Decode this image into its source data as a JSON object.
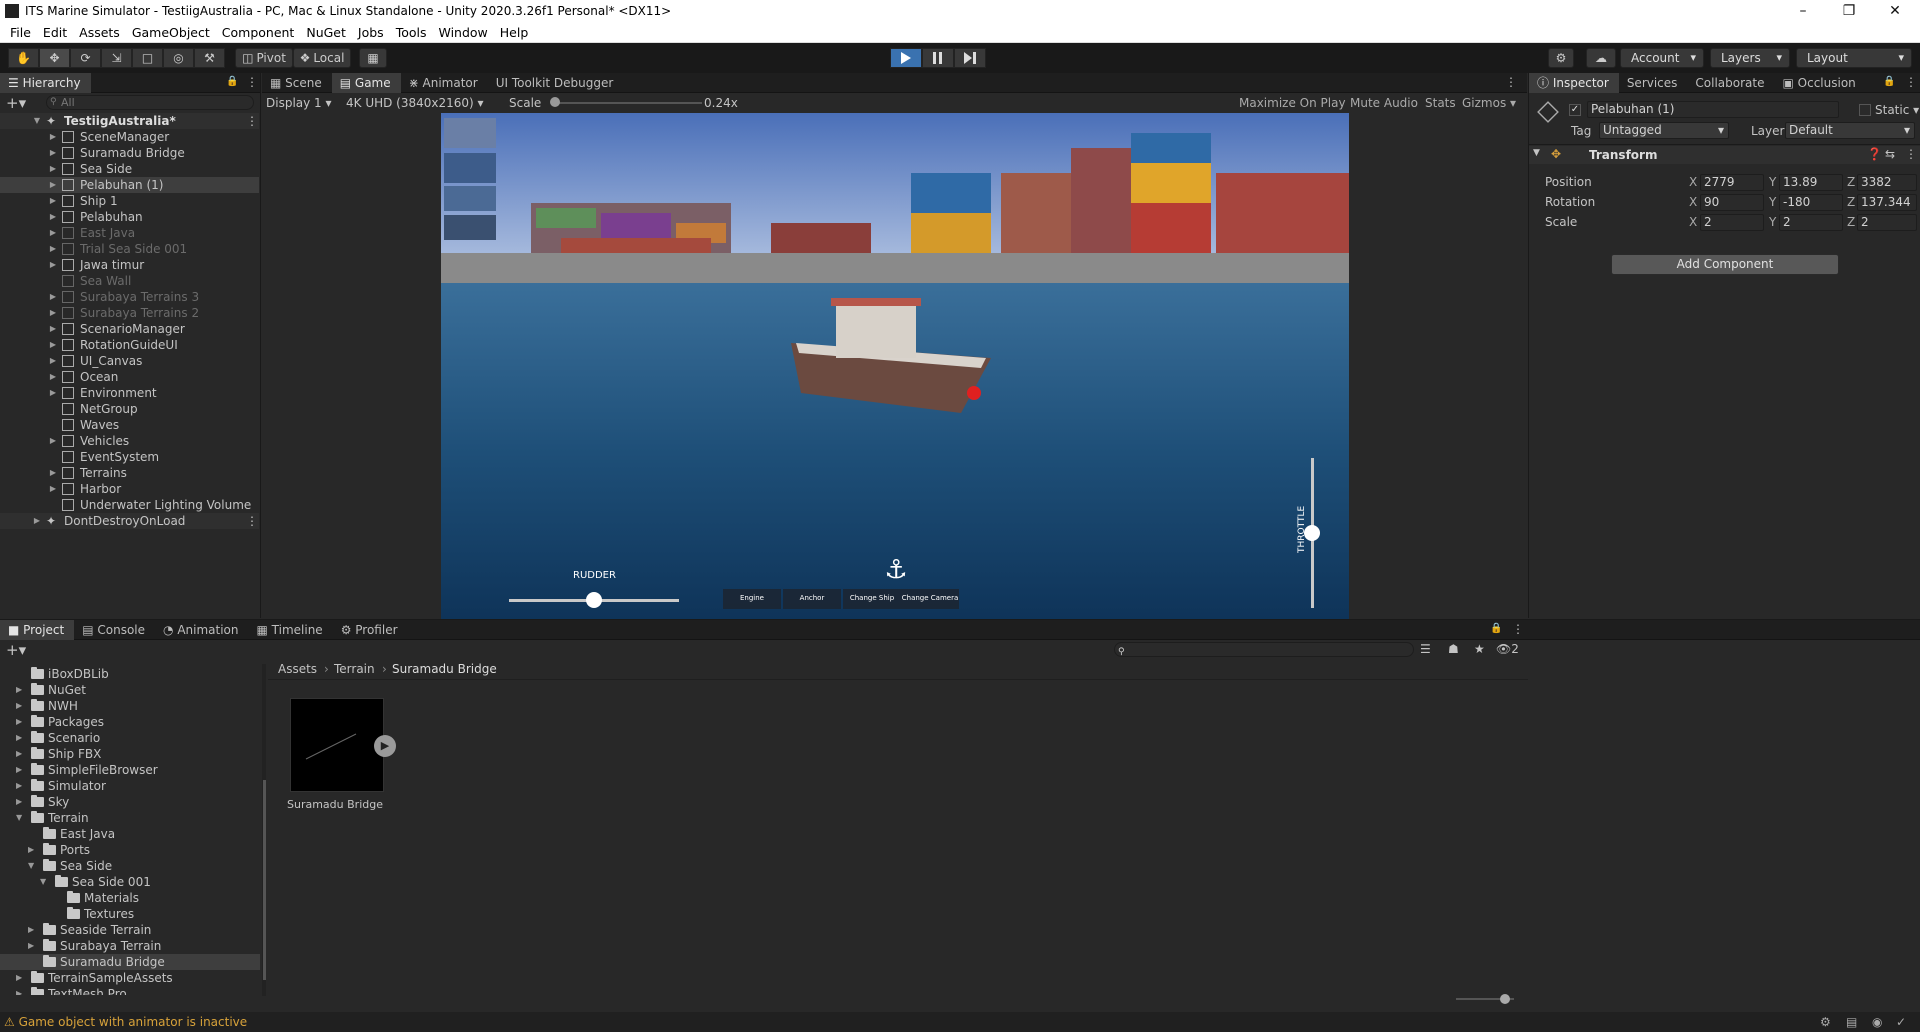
{
  "window": {
    "title": "ITS Marine Simulator - TestiigAustralia - PC, Mac & Linux Standalone - Unity 2020.3.26f1 Personal* <DX11>"
  },
  "menu": [
    "File",
    "Edit",
    "Assets",
    "GameObject",
    "Component",
    "NuGet",
    "Jobs",
    "Tools",
    "Window",
    "Help"
  ],
  "toolbar": {
    "pivot": "Pivot",
    "local": "Local",
    "account": "Account",
    "layers": "Layers",
    "layout": "Layout"
  },
  "hierarchy": {
    "tab": "Hierarchy",
    "search_placeholder": "All",
    "scene": "TestiigAustralia*",
    "items": [
      {
        "name": "SceneManager",
        "dim": false,
        "arrow": true
      },
      {
        "name": "Suramadu Bridge",
        "dim": false,
        "arrow": true
      },
      {
        "name": "Sea Side",
        "dim": false,
        "arrow": true
      },
      {
        "name": "Pelabuhan (1)",
        "dim": false,
        "arrow": true,
        "selected": true
      },
      {
        "name": "Ship 1",
        "dim": false,
        "arrow": true
      },
      {
        "name": "Pelabuhan",
        "dim": false,
        "arrow": true
      },
      {
        "name": "East Java",
        "dim": true,
        "arrow": true
      },
      {
        "name": "Trial Sea Side 001",
        "dim": true,
        "arrow": true
      },
      {
        "name": "Jawa timur",
        "dim": false,
        "arrow": true
      },
      {
        "name": "Sea Wall",
        "dim": true,
        "arrow": false
      },
      {
        "name": "Surabaya Terrains 3",
        "dim": true,
        "arrow": true
      },
      {
        "name": "Surabaya Terrains 2",
        "dim": true,
        "arrow": true
      },
      {
        "name": "ScenarioManager",
        "dim": false,
        "arrow": true
      },
      {
        "name": "RotationGuideUI",
        "dim": false,
        "arrow": true
      },
      {
        "name": "UI_Canvas",
        "dim": false,
        "arrow": true
      },
      {
        "name": "Ocean",
        "dim": false,
        "arrow": true
      },
      {
        "name": "Environment",
        "dim": false,
        "arrow": true
      },
      {
        "name": "NetGroup",
        "dim": false,
        "arrow": false
      },
      {
        "name": "Waves",
        "dim": false,
        "arrow": false
      },
      {
        "name": "Vehicles",
        "dim": false,
        "arrow": true
      },
      {
        "name": "EventSystem",
        "dim": false,
        "arrow": false
      },
      {
        "name": "Terrains",
        "dim": false,
        "arrow": true
      },
      {
        "name": "Harbor",
        "dim": false,
        "arrow": true
      },
      {
        "name": "Underwater Lighting Volume",
        "dim": false,
        "arrow": false
      }
    ],
    "dontdestroy": "DontDestroyOnLoad"
  },
  "game": {
    "tabs": [
      "Scene",
      "Game",
      "Animator",
      "UI Toolkit Debugger"
    ],
    "display": "Display 1",
    "resolution": "4K UHD (3840x2160)",
    "scale_label": "Scale",
    "scale_value": "0.24x",
    "maximize": "Maximize On Play",
    "mute": "Mute Audio",
    "stats": "Stats",
    "gizmos": "Gizmos",
    "hud": {
      "rudder": "RUDDER",
      "throttle": "THROTTLE",
      "buttons": [
        "Engine",
        "Anchor",
        "Change Ship",
        "Change Camera"
      ]
    }
  },
  "inspector": {
    "tabs": [
      "Inspector",
      "Services",
      "Collaborate",
      "Occlusion"
    ],
    "object_name": "Pelabuhan (1)",
    "static": "Static",
    "tag_label": "Tag",
    "tag": "Untagged",
    "layer_label": "Layer",
    "layer": "Default",
    "component": "Transform",
    "position": {
      "label": "Position",
      "x": "2779",
      "y": "13.89",
      "z": "3382"
    },
    "rotation": {
      "label": "Rotation",
      "x": "90",
      "y": "-180",
      "z": "137.344"
    },
    "scale": {
      "label": "Scale",
      "x": "2",
      "y": "2",
      "z": "2"
    },
    "add_component": "Add Component"
  },
  "bottom": {
    "tabs": [
      "Project",
      "Console",
      "Animation",
      "Timeline",
      "Profiler"
    ],
    "breadcrumb": [
      "Assets",
      "Terrain",
      "Suramadu Bridge"
    ],
    "hidden_count": "2",
    "asset": {
      "name": "Suramadu Bridge"
    },
    "folders": [
      {
        "name": "iBoxDBLib",
        "depth": 0,
        "arrow": false,
        "open": false
      },
      {
        "name": "NuGet",
        "depth": 0,
        "arrow": true,
        "open": false
      },
      {
        "name": "NWH",
        "depth": 0,
        "arrow": true,
        "open": false
      },
      {
        "name": "Packages",
        "depth": 0,
        "arrow": true,
        "open": false
      },
      {
        "name": "Scenario",
        "depth": 0,
        "arrow": true,
        "open": false
      },
      {
        "name": "Ship FBX",
        "depth": 0,
        "arrow": true,
        "open": false
      },
      {
        "name": "SimpleFileBrowser",
        "depth": 0,
        "arrow": true,
        "open": false
      },
      {
        "name": "Simulator",
        "depth": 0,
        "arrow": true,
        "open": false
      },
      {
        "name": "Sky",
        "depth": 0,
        "arrow": true,
        "open": false
      },
      {
        "name": "Terrain",
        "depth": 0,
        "arrow": true,
        "open": true
      },
      {
        "name": "East Java",
        "depth": 1,
        "arrow": false,
        "open": false
      },
      {
        "name": "Ports",
        "depth": 1,
        "arrow": true,
        "open": false
      },
      {
        "name": "Sea Side",
        "depth": 1,
        "arrow": true,
        "open": true
      },
      {
        "name": "Sea Side 001",
        "depth": 2,
        "arrow": true,
        "open": true
      },
      {
        "name": "Materials",
        "depth": 3,
        "arrow": false,
        "open": false
      },
      {
        "name": "Textures",
        "depth": 3,
        "arrow": false,
        "open": false
      },
      {
        "name": "Seaside Terrain",
        "depth": 1,
        "arrow": true,
        "open": false
      },
      {
        "name": "Surabaya Terrain",
        "depth": 1,
        "arrow": true,
        "open": false
      },
      {
        "name": "Suramadu Bridge",
        "depth": 1,
        "arrow": false,
        "open": false,
        "selected": true
      },
      {
        "name": "TerrainSampleAssets",
        "depth": 0,
        "arrow": true,
        "open": false
      },
      {
        "name": "TextMesh Pro",
        "depth": 0,
        "arrow": true,
        "open": false
      }
    ]
  },
  "status": {
    "message": "Game object with animator is inactive"
  },
  "colors": {
    "accent": "#3a72b0",
    "selection": "#2c5d87",
    "status_warning": "#d7a23a"
  }
}
